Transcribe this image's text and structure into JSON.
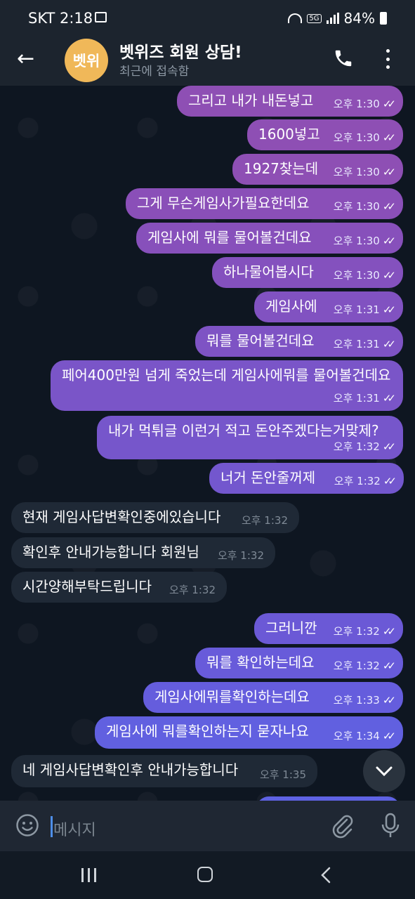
{
  "status_bar": {
    "time": "SKT 2:18",
    "network": "5G",
    "battery": "84%"
  },
  "header": {
    "avatar_text": "벳위",
    "title": "벳위즈 회원 상담!",
    "subtitle": "최근에 접속함",
    "avatar_color": "#f0b859"
  },
  "messages": [
    {
      "dir": "out",
      "text": "그리고 내가 내돈넣고",
      "time": "오후 1:30",
      "color": "#8e4fb4"
    },
    {
      "dir": "out",
      "text": "1600넣고",
      "time": "오후 1:30",
      "color": "#8e4fb4"
    },
    {
      "dir": "out",
      "text": "1927찾는데",
      "time": "오후 1:30",
      "color": "#8e4fb4"
    },
    {
      "dir": "out",
      "text": "그게 무슨게임사가필요한데요",
      "time": "오후 1:30",
      "color": "#8a4fb8"
    },
    {
      "dir": "out",
      "text": "게임사에 뭐를 물어볼건데요",
      "time": "오후 1:30",
      "color": "#8750bb"
    },
    {
      "dir": "out",
      "text": "하나물어봅시다",
      "time": "오후 1:30",
      "color": "#8451be"
    },
    {
      "dir": "out",
      "text": "게임사에",
      "time": "오후 1:31",
      "color": "#8152c1"
    },
    {
      "dir": "out",
      "text": "뭐를 물어볼건데요",
      "time": "오후 1:31",
      "color": "#7e53c4"
    },
    {
      "dir": "out",
      "text": "페어400만원 넘게 죽었는데 게임사에뭐를 물어볼건데요",
      "time": "오후 1:31",
      "color": "#7a55c8"
    },
    {
      "dir": "out",
      "text": "내가 먹튀글 이런거 적고 돈안주겠다는거맞제?",
      "time": "오후 1:32",
      "color": "#7656cb"
    },
    {
      "dir": "out",
      "text": "너거 돈안줄꺼제",
      "time": "오후 1:32",
      "color": "#7357ce"
    },
    {
      "dir": "in",
      "text": "현재 게임사답변확인중에있습니다",
      "time": "오후 1:32"
    },
    {
      "dir": "in",
      "text": "확인후 안내가능합니다 회원님",
      "time": "오후 1:32"
    },
    {
      "dir": "in",
      "text": "시간양해부탁드립니다",
      "time": "오후 1:32"
    },
    {
      "dir": "out",
      "text": "그러니깐",
      "time": "오후 1:32",
      "color": "#6b59d6"
    },
    {
      "dir": "out",
      "text": "뭐를 확인하는데요",
      "time": "오후 1:32",
      "color": "#685bda"
    },
    {
      "dir": "out",
      "text": "게임사에뭐를확인하는데요",
      "time": "오후 1:33",
      "color": "#655ddd"
    },
    {
      "dir": "out",
      "text": "게임사에 뭐를확인하는지 묻자나요",
      "time": "오후 1:34",
      "color": "#6160e0"
    },
    {
      "dir": "in",
      "text": "네 게임사답변확인후 안내가능합니다",
      "time": "오후 1:35"
    }
  ],
  "input": {
    "placeholder": "메시지"
  }
}
